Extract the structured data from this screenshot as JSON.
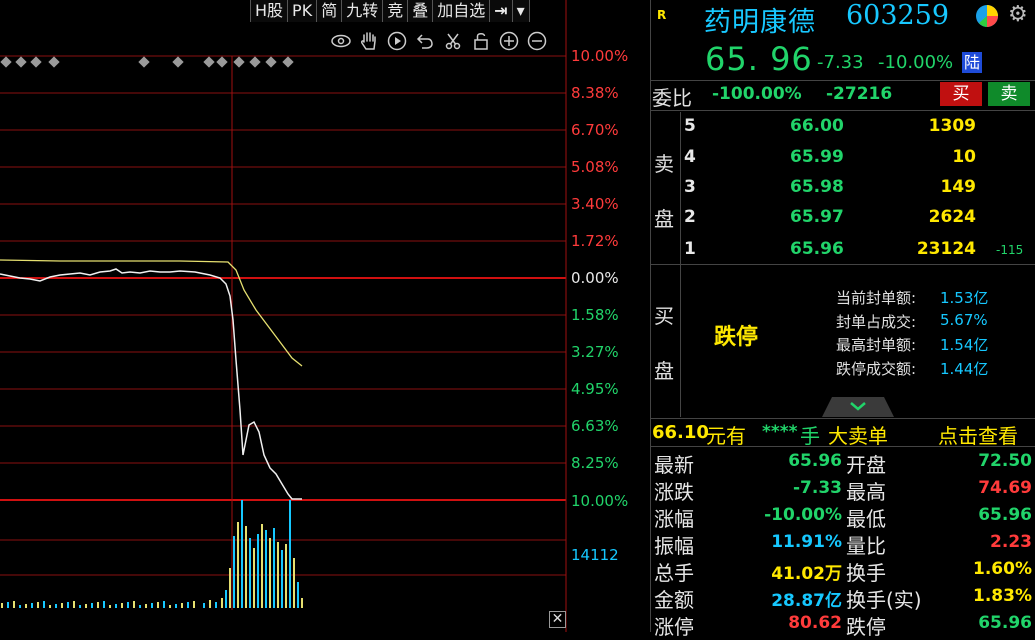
{
  "toolbar": [
    "H股",
    "PK",
    "简",
    "九转",
    "竞",
    "叠",
    "加自选"
  ],
  "tool_icons": [
    "eye-icon",
    "hand-icon",
    "play-circle-icon",
    "undo-icon",
    "scissors-icon",
    "lock-icon",
    "zoom-in-icon",
    "zoom-out-icon"
  ],
  "axis_labels": {
    "up": [
      "10.00%",
      "8.38%",
      "6.70%",
      "5.08%",
      "3.40%",
      "1.72%"
    ],
    "zero": "0.00%",
    "down": [
      "1.58%",
      "3.27%",
      "4.95%",
      "6.63%",
      "8.25%",
      "10.00%"
    ],
    "volume": "14112"
  },
  "stock": {
    "r_badge": "R",
    "name": "药明康德",
    "code": "603259",
    "price": "65. 96",
    "change": "-7.33",
    "change_pct": "-10.00%",
    "exchange": "陆"
  },
  "weibi": {
    "label": "委比",
    "pct": "-100.00%",
    "diff": "-27216",
    "buy": "买",
    "sell": "卖"
  },
  "sell_label": [
    "卖",
    "盘"
  ],
  "sell_orders": [
    {
      "level": "5",
      "price": "66.00",
      "vol": "1309",
      "extra": ""
    },
    {
      "level": "4",
      "price": "65.99",
      "vol": "10",
      "extra": ""
    },
    {
      "level": "3",
      "price": "65.98",
      "vol": "149",
      "extra": ""
    },
    {
      "level": "2",
      "price": "65.97",
      "vol": "2624",
      "extra": ""
    },
    {
      "level": "1",
      "price": "65.96",
      "vol": "23124",
      "extra": "-115"
    }
  ],
  "buy_label": [
    "买",
    "盘"
  ],
  "limit_down": "跌停",
  "seal": [
    {
      "label": "当前封单额:",
      "value": "1.53亿"
    },
    {
      "label": "封单占成交:",
      "value": "5.67%"
    },
    {
      "label": "最高封单额:",
      "value": "1.54亿"
    },
    {
      "label": "跌停成交额:",
      "value": "1.44亿"
    }
  ],
  "big_order": {
    "price": "66.10",
    "unit": "元有",
    "stars": "****",
    "hand": "手",
    "text": "大卖单",
    "link": "点击查看"
  },
  "stats": [
    {
      "l1": "最新",
      "v1": "65.96",
      "c1": "#21d46a",
      "l2": "开盘",
      "v2": "72.50",
      "c2": "#21d46a"
    },
    {
      "l1": "涨跌",
      "v1": "-7.33",
      "c1": "#21d46a",
      "l2": "最高",
      "v2": "74.69",
      "c2": "#ff3b3b"
    },
    {
      "l1": "涨幅",
      "v1": "-10.00%",
      "c1": "#21d46a",
      "l2": "最低",
      "v2": "65.96",
      "c2": "#21d46a"
    },
    {
      "l1": "振幅",
      "v1": "11.91%",
      "c1": "#16c8ff",
      "l2": "量比",
      "v2": "2.23",
      "c2": "#ff3b3b"
    },
    {
      "l1": "总手",
      "v1": "41.02万",
      "c1": "#ffe800",
      "l2": "换手",
      "v2": "1.60%",
      "c2": "#ffe800"
    },
    {
      "l1": "金额",
      "v1": "28.87亿",
      "c1": "#16c8ff",
      "l2": "换手(实)",
      "v2": "1.83%",
      "c2": "#ffe800"
    },
    {
      "l1": "涨停",
      "v1": "80.62",
      "c1": "#ff3b3b",
      "l2": "跌停",
      "v2": "65.96",
      "c2": "#21d46a"
    }
  ],
  "colors": {
    "up": "#ff3b3b",
    "down": "#21d46a",
    "accent": "#16c8ff",
    "avg": "#e6e070"
  }
}
